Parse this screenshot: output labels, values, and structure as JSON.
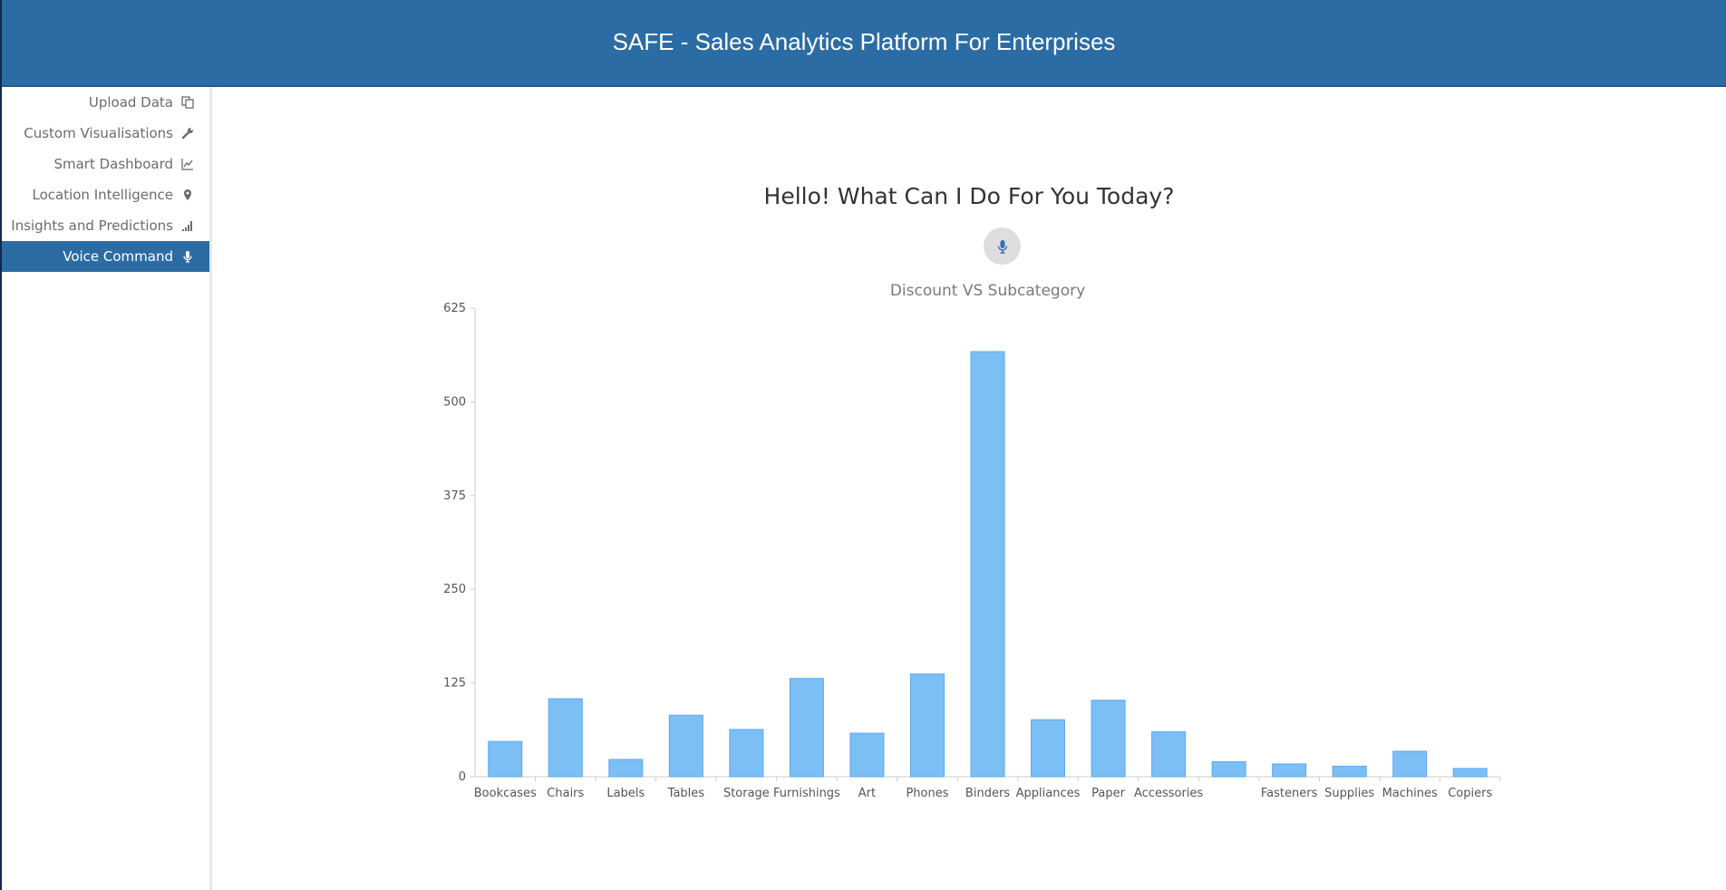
{
  "header": {
    "title": "SAFE - Sales Analytics Platform For Enterprises"
  },
  "sidebar": {
    "items": [
      {
        "label": "Upload Data",
        "icon": "copy-icon",
        "active": false
      },
      {
        "label": "Custom Visualisations",
        "icon": "wrench-icon",
        "active": false
      },
      {
        "label": "Smart Dashboard",
        "icon": "line-chart-icon",
        "active": false
      },
      {
        "label": "Location Intelligence",
        "icon": "map-pin-icon",
        "active": false
      },
      {
        "label": "Insights and Predictions",
        "icon": "signal-bars-icon",
        "active": false
      },
      {
        "label": "Voice Command",
        "icon": "microphone-icon",
        "active": true
      }
    ]
  },
  "main": {
    "greeting": "Hello! What Can I Do For You Today?",
    "mic_icon": "microphone-icon"
  },
  "colors": {
    "header_bg": "#2c6ca4",
    "active_item_bg": "#2c6ca4",
    "bar_fill": "#7cbff5",
    "bar_stroke": "#5aa8ee"
  },
  "chart_data": {
    "type": "bar",
    "title": "Discount VS Subcategory",
    "xlabel": "",
    "ylabel": "",
    "categories": [
      "Bookcases",
      "Chairs",
      "Labels",
      "Tables",
      "Storage",
      "Furnishings",
      "Art",
      "Phones",
      "Binders",
      "Appliances",
      "Paper",
      "Accessories",
      "",
      "Fasteners",
      "Supplies",
      "Machines",
      "Copiers"
    ],
    "values": [
      47,
      104,
      23,
      82,
      63,
      131,
      58,
      137,
      567,
      76,
      102,
      60,
      20,
      17,
      14,
      34,
      11
    ],
    "ylim": [
      0,
      625
    ],
    "yticks": [
      0,
      125,
      250,
      375,
      500,
      625
    ],
    "grid": false,
    "legend": "none"
  }
}
